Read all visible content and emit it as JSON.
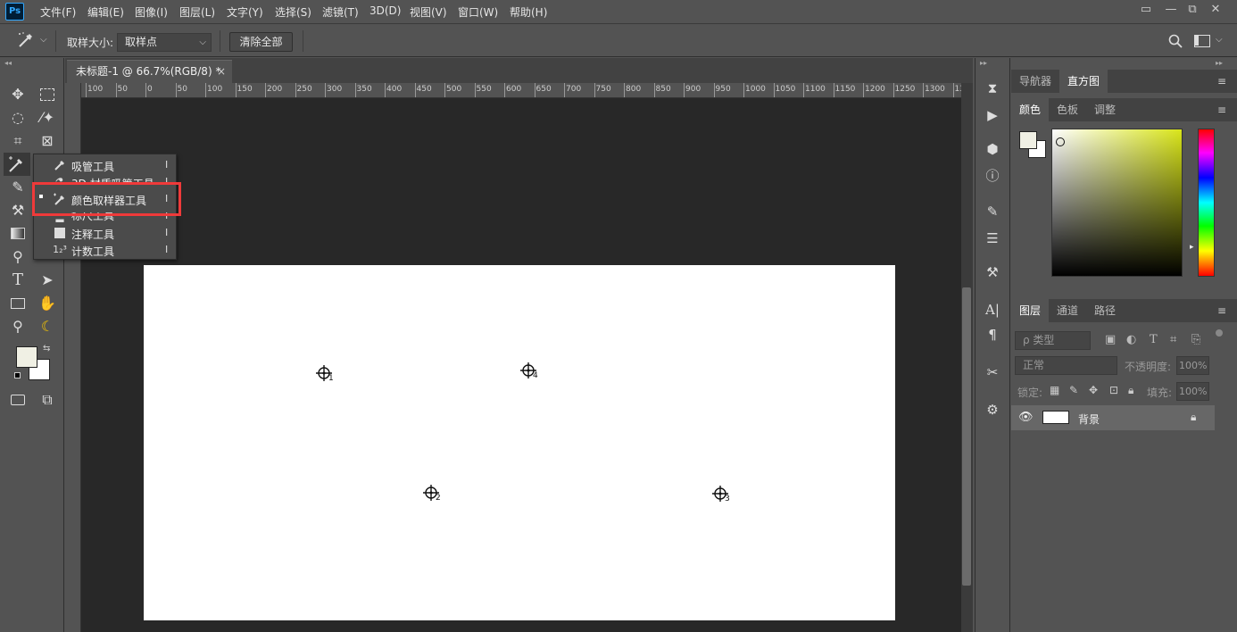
{
  "app": {
    "logo": "Ps"
  },
  "menubar": {
    "items": [
      "文件(F)",
      "编辑(E)",
      "图像(I)",
      "图层(L)",
      "文字(Y)",
      "选择(S)",
      "滤镜(T)",
      "3D(D)",
      "视图(V)",
      "窗口(W)",
      "帮助(H)"
    ],
    "window_buttons": [
      "▭",
      "—",
      "⧉",
      "✕"
    ]
  },
  "options_bar": {
    "sample_size_label": "取样大小:",
    "sample_size_value": "取样点",
    "clear_all_label": "清除全部"
  },
  "document": {
    "tab_title": "未标题-1 @ 66.7%(RGB/8) *",
    "close": "×",
    "ruler_ticks": [
      "100",
      "50",
      "0",
      "50",
      "100",
      "150",
      "200",
      "250",
      "300",
      "350",
      "400",
      "450",
      "500",
      "550",
      "600",
      "650",
      "700",
      "750",
      "800",
      "850",
      "900",
      "950",
      "1000",
      "1050",
      "1100",
      "1150",
      "1200",
      "1250",
      "1300",
      "13"
    ],
    "samplers": [
      "1",
      "2",
      "3",
      "4"
    ]
  },
  "tool_flyout": {
    "items": [
      {
        "label": "吸管工具",
        "key": "I",
        "icon": "eyedropper-icon"
      },
      {
        "label": "3D 材质吸管工具",
        "key": "I",
        "icon": "3d-material-eyedropper-icon"
      },
      {
        "label": "颜色取样器工具",
        "key": "I",
        "icon": "color-sampler-icon",
        "selected": true
      },
      {
        "label": "标尺工具",
        "key": "I",
        "icon": "ruler-icon"
      },
      {
        "label": "注释工具",
        "key": "I",
        "icon": "note-icon"
      },
      {
        "label": "计数工具",
        "key": "I",
        "icon": "count-icon"
      }
    ],
    "count_glyph": "1₂³"
  },
  "panels": {
    "top_tabs": [
      "导航器",
      "直方图"
    ],
    "color_tabs": [
      "颜色",
      "色板",
      "调整"
    ],
    "layer_tabs": [
      "图层",
      "通道",
      "路径"
    ],
    "filter_placeholder": "ρ 类型",
    "blend_mode": "正常",
    "opacity_label": "不透明度:",
    "opacity_value": "100%",
    "lock_label": "锁定:",
    "fill_label": "填充:",
    "fill_value": "100%",
    "layer_name": "背景"
  },
  "colors": {
    "highlight": "#ef3a3a",
    "foreground": "#f0f0e4",
    "background": "#ffffff",
    "picker_hue": "#d9e51a"
  }
}
